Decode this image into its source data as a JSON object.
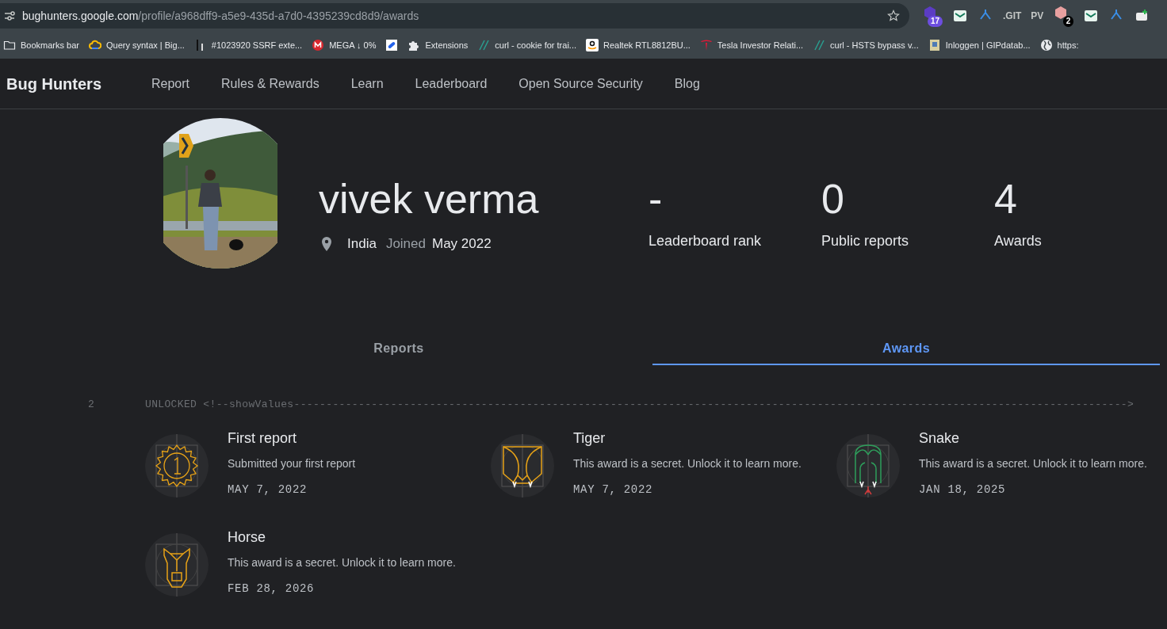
{
  "browser": {
    "url_host": "bughunters.google.com",
    "url_path": "/profile/a968dff9-a5e9-435d-a7d0-4395239cd8d9/awards",
    "extensions": [
      {
        "kind": "badge",
        "text": "17"
      },
      {
        "kind": "icon"
      },
      {
        "kind": "icon"
      },
      {
        "kind": "text",
        "text": ".GIT"
      },
      {
        "kind": "text",
        "text": "PV"
      },
      {
        "kind": "badge",
        "text": "2"
      },
      {
        "kind": "icon"
      },
      {
        "kind": "icon"
      },
      {
        "kind": "icon"
      }
    ],
    "bookmarks": [
      {
        "kind": "folder",
        "label": "Bookmarks bar"
      },
      {
        "kind": "cloud",
        "label": "Query syntax  |  Big..."
      },
      {
        "kind": "h1",
        "label": "#1023920 SSRF exte..."
      },
      {
        "kind": "mega",
        "label": "MEGA ↓ 0%"
      },
      {
        "kind": "pill"
      },
      {
        "kind": "puzzle",
        "label": "Extensions"
      },
      {
        "kind": "curl",
        "label": "curl - cookie for trai..."
      },
      {
        "kind": "amazon",
        "label": "Realtek RTL8812BU..."
      },
      {
        "kind": "tesla",
        "label": "Tesla Investor Relati..."
      },
      {
        "kind": "curl",
        "label": "curl - HSTS bypass v..."
      },
      {
        "kind": "doc",
        "label": "Inloggen | GIPdatab..."
      },
      {
        "kind": "globe",
        "label": "https:"
      }
    ]
  },
  "site": {
    "logo": "Bug Hunters",
    "nav": [
      "Report",
      "Rules & Rewards",
      "Learn",
      "Leaderboard",
      "Open Source Security",
      "Blog"
    ]
  },
  "profile": {
    "name": "vivek verma",
    "country": "India",
    "joined_label": "Joined",
    "joined": "May 2022",
    "stats": [
      {
        "value": "-",
        "label": "Leaderboard rank"
      },
      {
        "value": "0",
        "label": "Public reports"
      },
      {
        "value": "4",
        "label": "Awards"
      }
    ]
  },
  "tabs": [
    {
      "label": "Reports",
      "selected": false
    },
    {
      "label": "Awards",
      "selected": true
    }
  ],
  "debug_line": {
    "number": "2",
    "text": "UNLOCKED <!--showValues--------------------------------------------------------------------------------------------------------------------------------->"
  },
  "awards": [
    {
      "kind": "medal",
      "title": "First report",
      "description": "Submitted your first report",
      "date": "MAY 7, 2022"
    },
    {
      "kind": "tiger",
      "title": "Tiger",
      "description": "This award is a secret. Unlock it to learn more.",
      "date": "MAY 7, 2022"
    },
    {
      "kind": "snake",
      "title": "Snake",
      "description": "This award is a secret. Unlock it to learn more.",
      "date": "JAN 18, 2025"
    },
    {
      "kind": "horse",
      "title": "Horse",
      "description": "This award is a secret. Unlock it to learn more.",
      "date": "FEB 28, 2026"
    }
  ]
}
